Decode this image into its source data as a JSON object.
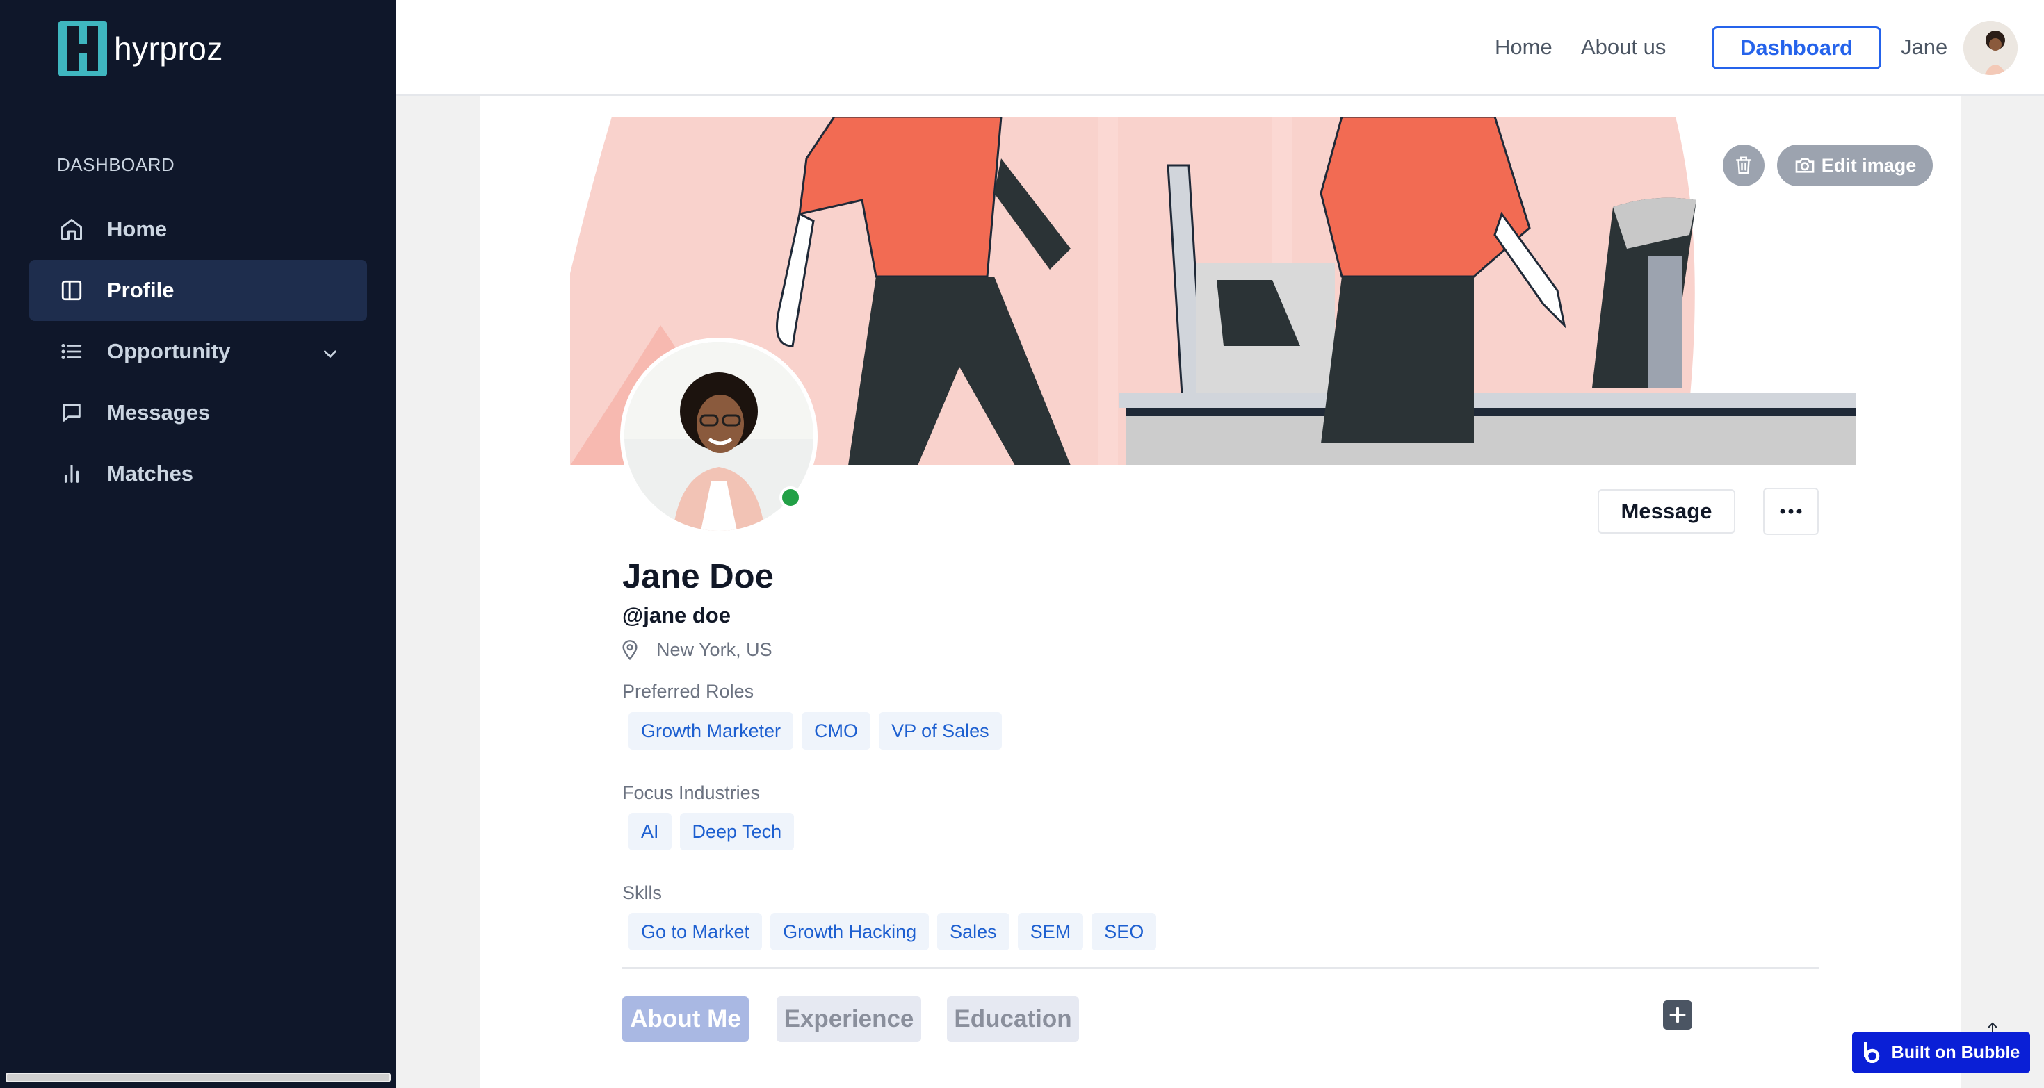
{
  "app": {
    "brand": "hyrproz"
  },
  "sidebar": {
    "section": "DASHBOARD",
    "items": [
      {
        "label": "Home",
        "icon": "home-icon"
      },
      {
        "label": "Profile",
        "icon": "profile-icon",
        "active": true
      },
      {
        "label": "Opportunity",
        "icon": "list-icon",
        "expandable": true
      },
      {
        "label": "Messages",
        "icon": "message-icon"
      },
      {
        "label": "Matches",
        "icon": "bar-chart-icon"
      }
    ]
  },
  "topnav": {
    "home": "Home",
    "about": "About us",
    "dashboard": "Dashboard",
    "user_name": "Jane"
  },
  "banner": {
    "edit_label": "Edit image",
    "delete_icon": "trash-icon"
  },
  "profile": {
    "name": "Jane Doe",
    "handle": "@jane doe",
    "location": "New York, US",
    "message_button": "Message",
    "preferred_roles_label": "Preferred Roles",
    "preferred_roles": [
      "Growth Marketer",
      "CMO",
      "VP of Sales"
    ],
    "focus_industries_label": "Focus Industries",
    "focus_industries": [
      "AI",
      "Deep Tech"
    ],
    "skills_label": "Sklls",
    "skills": [
      "Go to Market",
      "Growth Hacking",
      "Sales",
      "SEM",
      "SEO"
    ]
  },
  "tabs": [
    "About Me",
    "Experience",
    "Education"
  ],
  "footer": {
    "bubble_label": "Built on Bubble"
  },
  "colors": {
    "accent": "#2563eb",
    "sidebar": "#0f172a",
    "online": "#22a046",
    "tag_text": "#1d5fd0"
  }
}
